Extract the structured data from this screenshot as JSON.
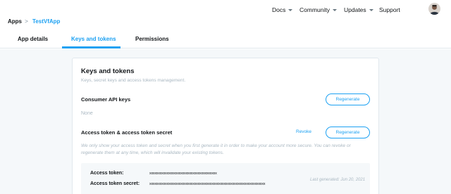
{
  "header": {
    "nav": [
      {
        "label": "Docs",
        "has_caret": true
      },
      {
        "label": "Community",
        "has_caret": true
      },
      {
        "label": "Updates",
        "has_caret": true
      },
      {
        "label": "Support",
        "has_caret": false
      }
    ]
  },
  "breadcrumb": {
    "apps": "Apps",
    "separator": ">",
    "app_name": "TestVfApp"
  },
  "tabs": [
    {
      "label": "App details",
      "active": false
    },
    {
      "label": "Keys and tokens",
      "active": true
    },
    {
      "label": "Permissions",
      "active": false
    }
  ],
  "card": {
    "title": "Keys and tokens",
    "subtitle": "Keys, secret keys and access tokens management.",
    "consumer": {
      "title": "Consumer API keys",
      "value": "None",
      "regenerate_label": "Regenerate"
    },
    "access": {
      "title": "Access token & access token secret",
      "revoke_label": "Revoke",
      "regenerate_label": "Regenerate",
      "description": "We only show your access token and secret when you first generate it in order to make your account more secure. You can revoke or regenerate them at any time, which will invalidate your existing tokens.",
      "token_label": "Access token:",
      "token_value": "xxxxxxxxxxxxxxxxxxxxxxxxxxxxxxxxxxxxxxx",
      "secret_label": "Access token secret:",
      "secret_value": "xxxxxxxxxxxxxxxxxxxxxxxxxxxxxxxxxxxxxxxxxxxxxxxxxxxxxxxxxxxxxxxxxxx",
      "last_generated": "Last generated: Jun 20, 2021"
    }
  },
  "colors": {
    "accent": "#1da1f2",
    "muted_text": "#aab8c2",
    "page_background": "#f5f8fa"
  }
}
